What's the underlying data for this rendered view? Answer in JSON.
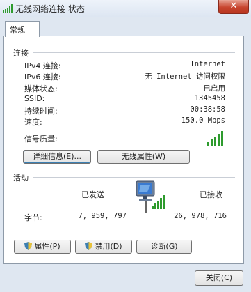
{
  "window": {
    "title": "无线网络连接 状态",
    "close_label": "✕"
  },
  "tabs": [
    {
      "label": "常规"
    }
  ],
  "connection": {
    "heading": "连接",
    "rows": [
      {
        "label": "IPv4 连接:",
        "value": "Internet"
      },
      {
        "label": "IPv6 连接:",
        "value": "无 Internet 访问权限"
      },
      {
        "label": "媒体状态:",
        "value": "已启用"
      },
      {
        "label": "SSID:",
        "value": "1345458"
      },
      {
        "label": "持续时间:",
        "value": "00:38:58"
      },
      {
        "label": "速度:",
        "value": "150.0 Mbps"
      }
    ],
    "signal_label": "信号质量:",
    "signal_level": "5 of 5 bars",
    "details_button": "详细信息(E)...",
    "wireless_props_button": "无线属性(W)"
  },
  "activity": {
    "heading": "活动",
    "sent_label": "已发送",
    "received_label": "已接收",
    "bytes_label": "字节:",
    "bytes_sent": "7, 959, 797",
    "bytes_received": "26, 978, 716"
  },
  "buttons": {
    "properties": "属性(P)",
    "disable": "禁用(D)",
    "diagnose": "诊断(G)",
    "close": "关闭(C)"
  },
  "colors": {
    "signal": "#2e9b2e",
    "accent": "#3c7fb1"
  }
}
